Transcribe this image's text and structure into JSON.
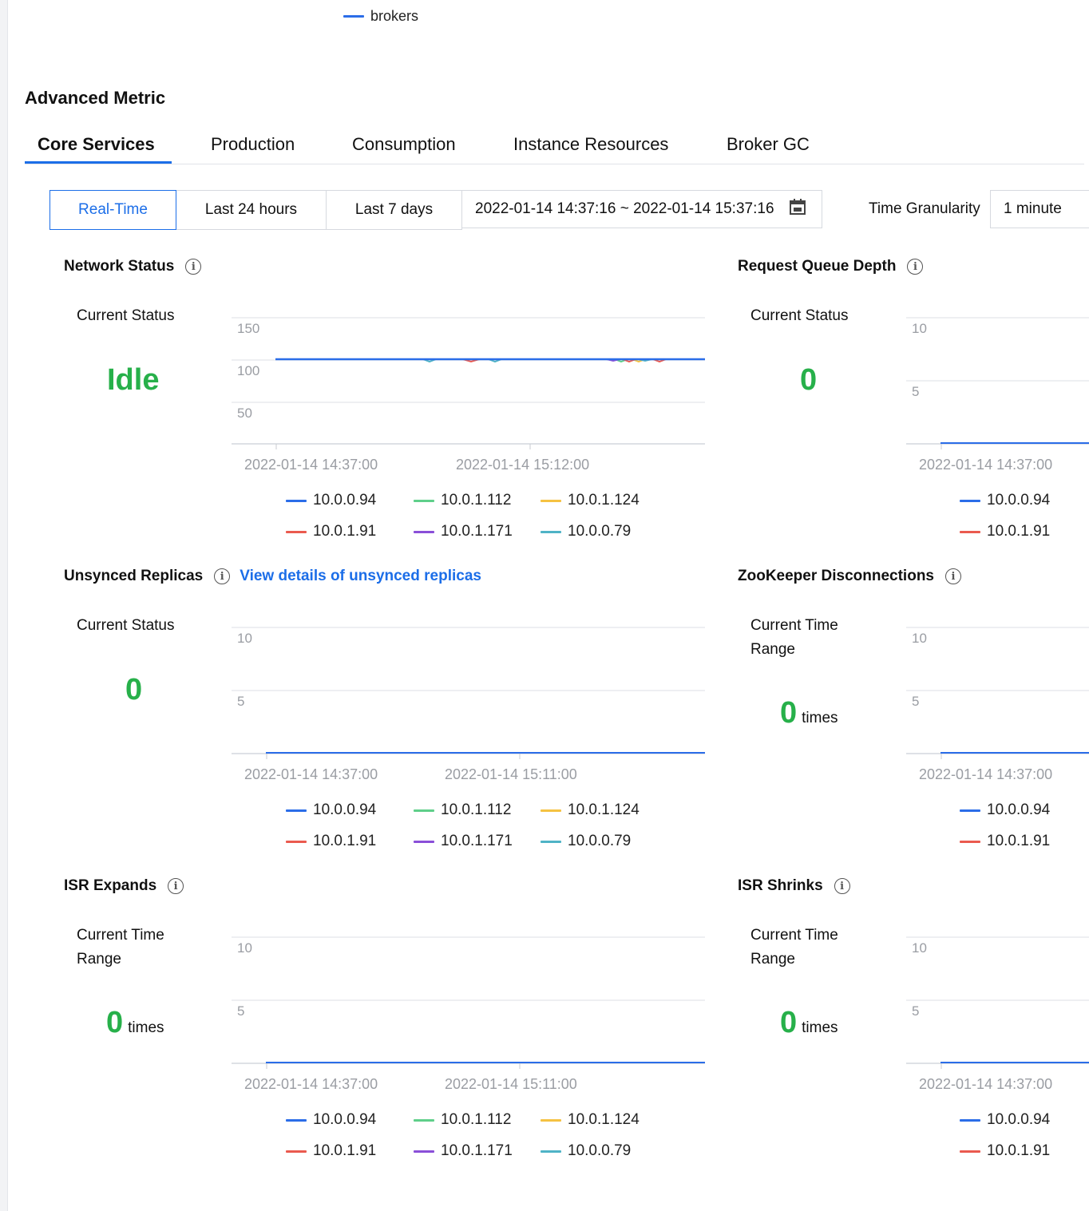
{
  "top_legend": {
    "label": "brokers",
    "color": "#2b6de8"
  },
  "section_title": "Advanced Metric",
  "tabs": [
    "Core Services",
    "Production",
    "Consumption",
    "Instance Resources",
    "Broker GC"
  ],
  "active_tab": "Core Services",
  "time_buttons": [
    "Real-Time",
    "Last 24 hours",
    "Last 7 days"
  ],
  "active_time_button": "Real-Time",
  "date_range": "2022-01-14 14:37:16 ~ 2022-01-14 15:37:16",
  "calendar_icon": "calendar-icon",
  "granularity": {
    "label": "Time Granularity",
    "value": "1 minute"
  },
  "series_colors": {
    "10.0.0.94": "#2b6de8",
    "10.0.1.112": "#5fcf8a",
    "10.0.1.124": "#f5c242",
    "10.0.1.91": "#ea5a4f",
    "10.0.1.171": "#8a4fd8",
    "10.0.0.79": "#4fb3c6"
  },
  "cards": {
    "network_status": {
      "title": "Network Status",
      "status_label": "Current Status",
      "value": "Idle",
      "chart_data": {
        "type": "line",
        "y_ticks": [
          "150",
          "100",
          "50"
        ],
        "x_ticks": [
          "2022-01-14 14:37:00",
          "2022-01-14 15:12:00"
        ],
        "series": [
          {
            "name": "10.0.0.94",
            "level": 100
          },
          {
            "name": "10.0.1.112",
            "level": 100
          },
          {
            "name": "10.0.1.124",
            "level": 100
          },
          {
            "name": "10.0.1.91",
            "level": 100
          },
          {
            "name": "10.0.1.171",
            "level": 100
          },
          {
            "name": "10.0.0.79",
            "level": 100
          }
        ]
      },
      "legend": [
        "10.0.0.94",
        "10.0.1.112",
        "10.0.1.124",
        "10.0.1.91",
        "10.0.1.171",
        "10.0.0.79"
      ]
    },
    "request_queue_depth": {
      "title": "Request Queue Depth",
      "status_label": "Current Status",
      "value": "0",
      "chart_data": {
        "type": "line",
        "y_ticks": [
          "10",
          "5"
        ],
        "x_ticks": [
          "2022-01-14 14:37:00"
        ],
        "series": [
          {
            "name": "10.0.0.94",
            "level": 0
          }
        ]
      },
      "legend": [
        "10.0.0.94",
        "10.0.1.91"
      ]
    },
    "unsynced_replicas": {
      "title": "Unsynced Replicas",
      "link": "View details of unsynced replicas",
      "status_label": "Current Status",
      "value": "0",
      "chart_data": {
        "type": "line",
        "y_ticks": [
          "10",
          "5"
        ],
        "x_ticks": [
          "2022-01-14 14:37:00",
          "2022-01-14 15:11:00"
        ],
        "series": [
          {
            "name": "10.0.0.94",
            "level": 0
          }
        ]
      },
      "legend": [
        "10.0.0.94",
        "10.0.1.112",
        "10.0.1.124",
        "10.0.1.91",
        "10.0.1.171",
        "10.0.0.79"
      ]
    },
    "zookeeper_disconnections": {
      "title": "ZooKeeper Disconnections",
      "status_label": "Current Time Range",
      "value": "0",
      "unit": "times",
      "chart_data": {
        "type": "line",
        "y_ticks": [
          "10",
          "5"
        ],
        "x_ticks": [
          "2022-01-14 14:37:00"
        ],
        "series": [
          {
            "name": "10.0.0.94",
            "level": 0
          }
        ]
      },
      "legend": [
        "10.0.0.94",
        "10.0.1.91"
      ]
    },
    "isr_expands": {
      "title": "ISR Expands",
      "status_label": "Current Time Range",
      "value": "0",
      "unit": "times",
      "chart_data": {
        "type": "line",
        "y_ticks": [
          "10",
          "5"
        ],
        "x_ticks": [
          "2022-01-14 14:37:00",
          "2022-01-14 15:11:00"
        ],
        "series": [
          {
            "name": "10.0.0.94",
            "level": 0
          }
        ]
      },
      "legend": [
        "10.0.0.94",
        "10.0.1.112",
        "10.0.1.124",
        "10.0.1.91",
        "10.0.1.171",
        "10.0.0.79"
      ]
    },
    "isr_shrinks": {
      "title": "ISR Shrinks",
      "status_label": "Current Time Range",
      "value": "0",
      "unit": "times",
      "chart_data": {
        "type": "line",
        "y_ticks": [
          "10",
          "5"
        ],
        "x_ticks": [
          "2022-01-14 14:37:00"
        ],
        "series": [
          {
            "name": "10.0.0.94",
            "level": 0
          }
        ]
      },
      "legend": [
        "10.0.0.94",
        "10.0.1.91"
      ]
    }
  }
}
